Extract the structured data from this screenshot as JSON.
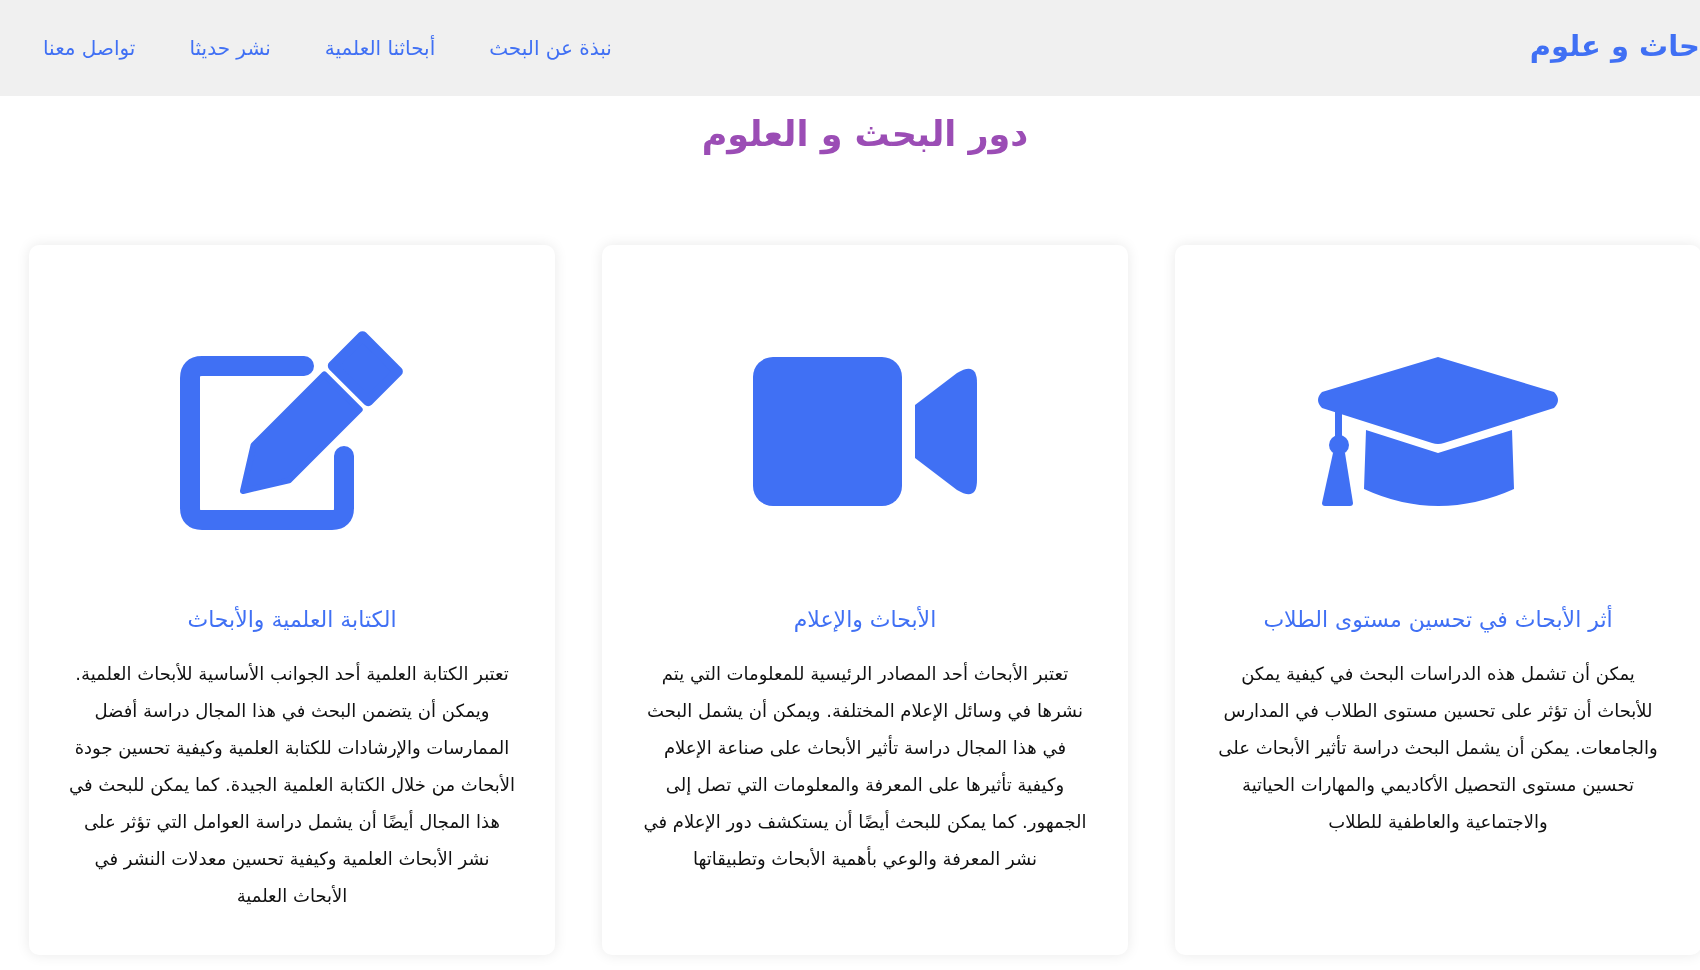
{
  "header": {
    "site_title": "حاث و علوم",
    "nav": [
      "نبذة عن البحث",
      "أبحاثنا العلمية",
      "نشر حديثا",
      "تواصل معنا"
    ]
  },
  "page_title": "دور البحث و العلوم",
  "cards": [
    {
      "title": "أثر الأبحاث في تحسين مستوى الطلاب",
      "body": "يمكن أن تشمل هذه الدراسات البحث في كيفية يمكن للأبحاث أن تؤثر على تحسين مستوى الطلاب في المدارس والجامعات. يمكن أن يشمل البحث دراسة تأثير الأبحاث على تحسين مستوى التحصيل الأكاديمي والمهارات الحياتية والاجتماعية والعاطفية للطلاب"
    },
    {
      "title": "الأبحاث والإعلام",
      "body": "تعتبر الأبحاث أحد المصادر الرئيسية للمعلومات التي يتم نشرها في وسائل الإعلام المختلفة. ويمكن أن يشمل البحث في هذا المجال دراسة تأثير الأبحاث على صناعة الإعلام وكيفية تأثيرها على المعرفة والمعلومات التي تصل إلى الجمهور. كما يمكن للبحث أيضًا أن يستكشف دور الإعلام في نشر المعرفة والوعي بأهمية الأبحاث وتطبيقاتها"
    },
    {
      "title": "الكتابة العلمية والأبحاث",
      "body": "تعتبر الكتابة العلمية أحد الجوانب الأساسية للأبحاث العلمية. ويمكن أن يتضمن البحث في هذا المجال دراسة أفضل الممارسات والإرشادات للكتابة العلمية وكيفية تحسين جودة الأبحاث من خلال الكتابة العلمية الجيدة. كما يمكن للبحث في هذا المجال أيضًا أن يشمل دراسة العوامل التي تؤثر على نشر الأبحاث العلمية وكيفية تحسين معدلات النشر في الأبحاث العلمية"
    }
  ]
}
